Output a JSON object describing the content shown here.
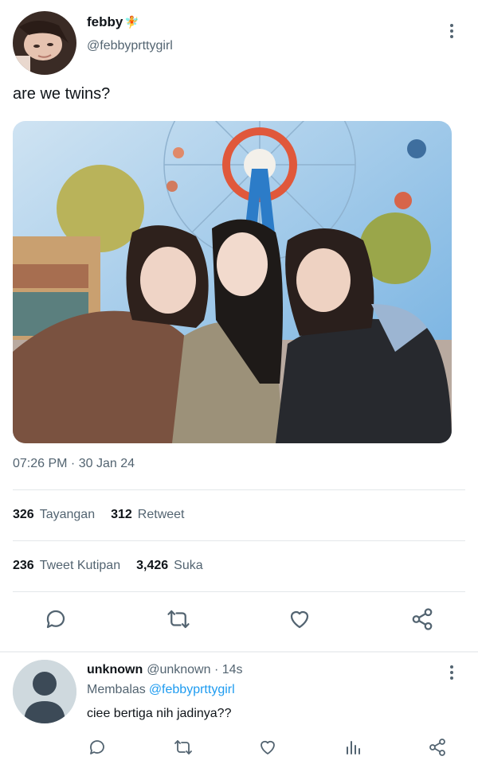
{
  "tweet": {
    "display_name": "febby",
    "name_emoji": "🧚",
    "handle": "@febbyprttygirl",
    "text": "are we twins?",
    "timestamp": "07:26 PM · 30 Jan 24",
    "stats": {
      "views_count": "326",
      "views_label": "Tayangan",
      "retweets_count": "312",
      "retweets_label": "Retweet",
      "quotes_count": "236",
      "quotes_label": "Tweet Kutipan",
      "likes_count": "3,426",
      "likes_label": "Suka"
    },
    "actions": [
      "reply-icon",
      "retweet-icon",
      "like-icon",
      "share-icon"
    ]
  },
  "reply": {
    "display_name": "unknown",
    "meta": "@unknown · 14s",
    "replying_label": "Membalas",
    "replying_to": "@febbyprttygirl",
    "text": "ciee bertiga nih jadinya??",
    "actions": [
      "reply-icon",
      "retweet-icon",
      "like-icon",
      "analytics-icon",
      "share-icon"
    ]
  },
  "colors": {
    "text_primary": "#0f1419",
    "text_secondary": "#536471",
    "link": "#1d9bf0",
    "divider": "#e3e7ea"
  }
}
